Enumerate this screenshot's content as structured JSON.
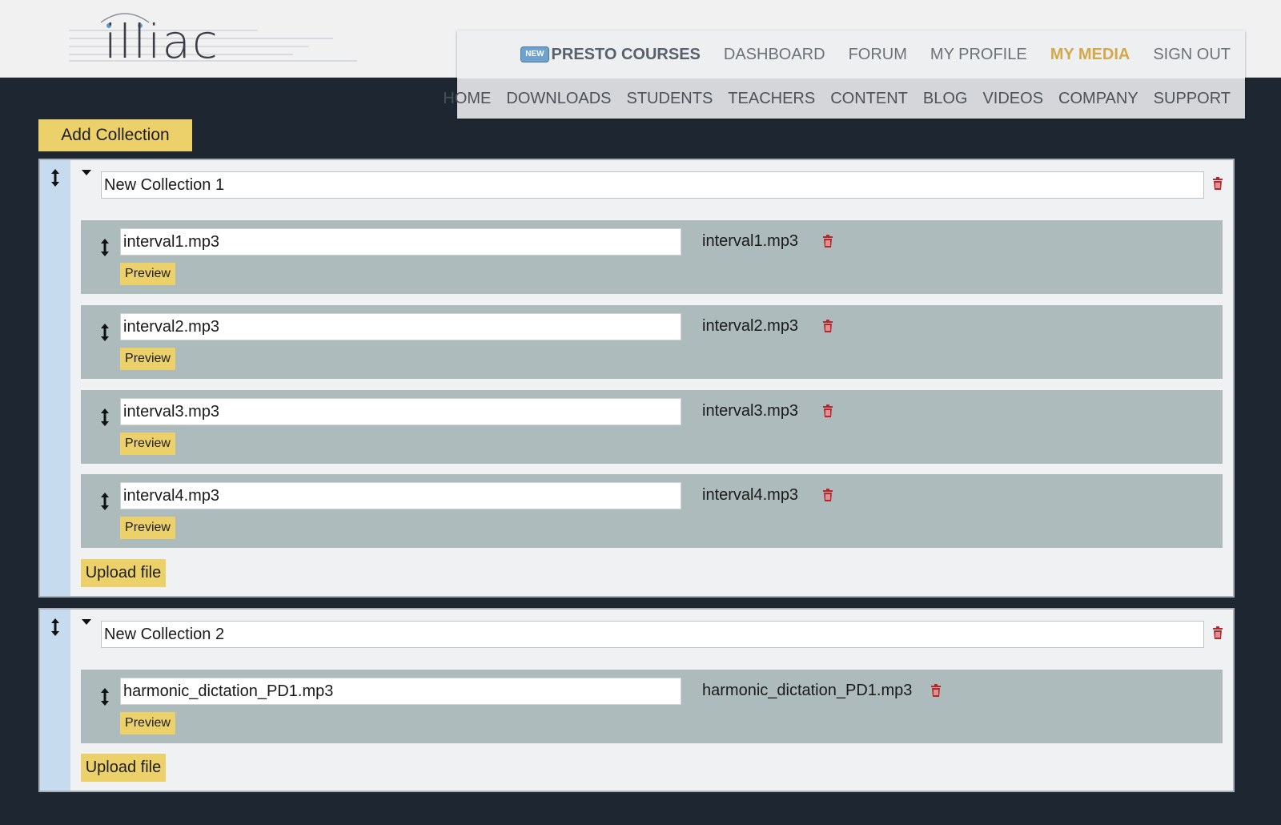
{
  "header": {
    "logo_text": "illiac",
    "presto": {
      "badge": "NEW",
      "label": "PRESTO COURSES"
    },
    "top_nav": [
      {
        "label": "DASHBOARD",
        "active": false
      },
      {
        "label": "FORUM",
        "active": false
      },
      {
        "label": "MY PROFILE",
        "active": false
      },
      {
        "label": "MY MEDIA",
        "active": true
      },
      {
        "label": "SIGN OUT",
        "active": false
      }
    ],
    "main_nav": [
      "HOME",
      "DOWNLOADS",
      "STUDENTS",
      "TEACHERS",
      "CONTENT",
      "BLOG",
      "VIDEOS",
      "COMPANY",
      "SUPPORT"
    ]
  },
  "toolbar": {
    "add_collection_label": "Add Collection"
  },
  "collections": [
    {
      "name": "New Collection 1",
      "files": [
        {
          "title": "interval1.mp3",
          "filename": "interval1.mp3",
          "preview_label": "Preview"
        },
        {
          "title": "interval2.mp3",
          "filename": "interval2.mp3",
          "preview_label": "Preview"
        },
        {
          "title": "interval3.mp3",
          "filename": "interval3.mp3",
          "preview_label": "Preview"
        },
        {
          "title": "interval4.mp3",
          "filename": "interval4.mp3",
          "preview_label": "Preview"
        }
      ],
      "upload_label": "Upload file"
    },
    {
      "name": "New Collection 2",
      "files": [
        {
          "title": "harmonic_dictation_PD1.mp3",
          "filename": "harmonic_dictation_PD1.mp3",
          "preview_label": "Preview"
        }
      ],
      "upload_label": "Upload file"
    }
  ],
  "colors": {
    "background": "#1e2631",
    "accent_yellow": "#ecd16b",
    "active_nav": "#d3a84a",
    "file_row": "#adbbbc",
    "handle_column": "#c7dbef",
    "trash": "#b8262b"
  }
}
